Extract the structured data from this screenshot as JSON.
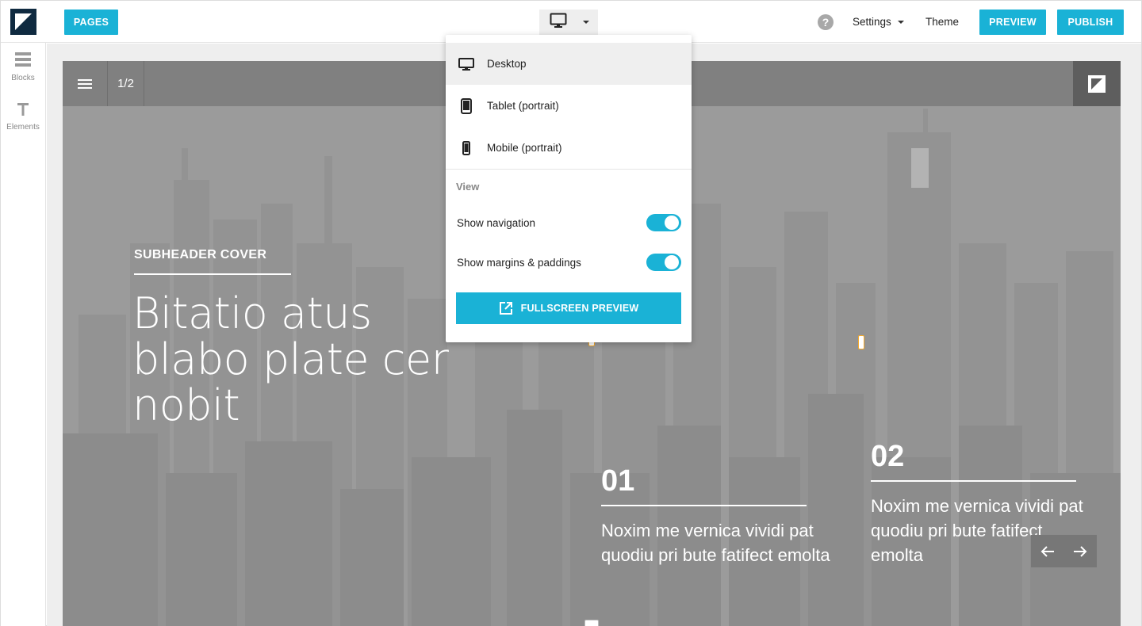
{
  "toolbar": {
    "pages_label": "PAGES",
    "device_icon": "desktop-icon",
    "help_icon": "help-icon",
    "help_glyph": "?",
    "settings_label": "Settings",
    "theme_label": "Theme",
    "preview_label": "PREVIEW",
    "publish_label": "PUBLISH",
    "accent": "#1ab2d6"
  },
  "sidebar": {
    "items": [
      {
        "label": "Blocks",
        "icon": "blocks-icon"
      },
      {
        "label": "Elements",
        "icon": "text-icon"
      }
    ]
  },
  "device_menu": {
    "options": [
      {
        "label": "Desktop",
        "icon": "desktop-icon",
        "selected": true
      },
      {
        "label": "Tablet (portrait)",
        "icon": "tablet-icon",
        "selected": false
      },
      {
        "label": "Mobile (portrait)",
        "icon": "mobile-icon",
        "selected": false
      }
    ],
    "view_heading": "View",
    "toggles": [
      {
        "label": "Show navigation",
        "on": true
      },
      {
        "label": "Show margins & paddings",
        "on": true
      }
    ],
    "fullscreen_label": "FULLSCREEN PREVIEW"
  },
  "page": {
    "nav_counter": "1/2",
    "subheader": "SUBHEADER COVER",
    "title": "Bitatio atus blabo plate cer nobit",
    "features": [
      {
        "number": "01",
        "text": "Noxim me vernica vividi pat quodiu pri bute fatifect emolta"
      },
      {
        "number": "02",
        "text": "Noxim me vernica vividi pat quodiu pri bute fatifect emolta"
      }
    ]
  }
}
